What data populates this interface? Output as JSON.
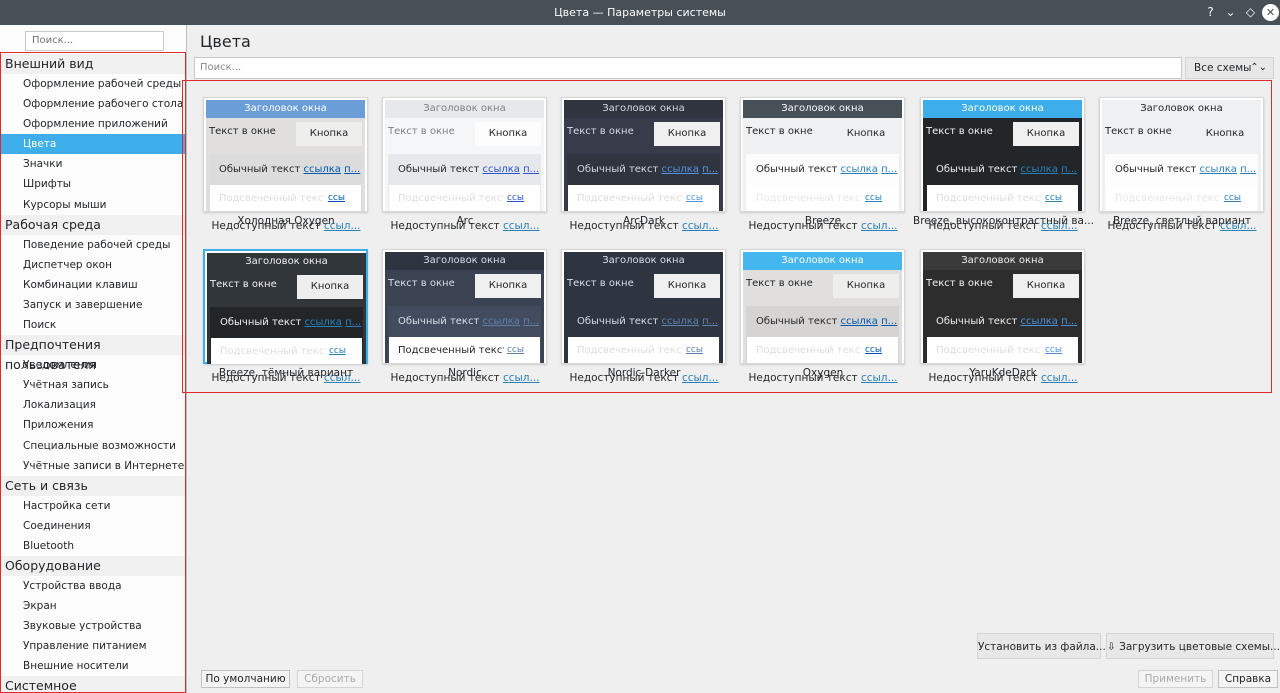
{
  "window": {
    "title": "Цвета — Параметры системы",
    "help_glyph": "?",
    "minimize_glyph": "⌄",
    "maximize_glyph": "◇",
    "close_glyph": "✕"
  },
  "sidebar": {
    "search_placeholder": "Поиск...",
    "sections": [
      {
        "title": "Внешний вид",
        "items": [
          "Оформление рабочей среды",
          "Оформление рабочего стола",
          "Оформление приложений",
          "Цвета",
          "Значки",
          "Шрифты",
          "Курсоры мыши"
        ]
      },
      {
        "title": "Рабочая среда",
        "items": [
          "Поведение рабочей среды",
          "Диспетчер окон",
          "Комбинации клавиш",
          "Запуск и завершение",
          "Поиск"
        ]
      },
      {
        "title": "Предпочтения пользователя",
        "items": [
          "Уведомления",
          "Учётная запись",
          "Локализация",
          "Приложения",
          "Специальные возможности",
          "Учётные записи в Интернете"
        ]
      },
      {
        "title": "Сеть и связь",
        "items": [
          "Настройка сети",
          "Соединения",
          "Bluetooth"
        ]
      },
      {
        "title": "Оборудование",
        "items": [
          "Устройства ввода",
          "Экран",
          "Звуковые устройства",
          "Управление питанием",
          "Внешние носители"
        ]
      },
      {
        "title": "Системное администрирование",
        "items": []
      }
    ],
    "selected_item": "Цвета"
  },
  "main": {
    "page_title": "Цвета",
    "search_placeholder": "Поиск...",
    "filter": {
      "value": "Все схемы",
      "arrow_glyph": "⌃⌄"
    }
  },
  "preview_text": {
    "window_title": "Заголовок окна",
    "window_text": "Текст в окне",
    "button": "Кнопка",
    "normal_text": "Обычный текст",
    "link": "ссылка",
    "visited": "п...",
    "highlighted_text": "Подсвеченный текст",
    "highlighted_link": "ссы",
    "inactive_text": "Недоступный текст",
    "inactive_link": "ссыл..."
  },
  "schemes": [
    {
      "name": "Холодная Oxygen",
      "selected": false,
      "colors": {
        "title_bg": "#6b9ed8",
        "title_fg": "#ffffff",
        "win_bg": "#e0dfde",
        "win_fg": "#232629",
        "btn_bg": "#eeeeec",
        "btn_fg": "#232629",
        "view_bg": "#dcdcdc",
        "view_fg": "#232629",
        "link": "#0057ae",
        "hi_bg": "#ffffff",
        "hi_fg": "#dcdcdc"
      }
    },
    {
      "name": "Arc",
      "selected": false,
      "colors": {
        "title_bg": "#e7e8eb",
        "title_fg": "#7d8287",
        "win_bg": "#f5f6f7",
        "win_fg": "#7d8287",
        "btn_bg": "#fcfcfc",
        "btn_fg": "#232629",
        "view_bg": "#e7e8eb",
        "view_fg": "#232629",
        "link": "#2b55cc",
        "hi_bg": "#ffffff",
        "hi_fg": "#dddddd"
      }
    },
    {
      "name": "ArcDark",
      "selected": false,
      "colors": {
        "title_bg": "#2f343f",
        "title_fg": "#d3dae3",
        "win_bg": "#383c4a",
        "win_fg": "#d3dae3",
        "btn_bg": "#f0f0f0",
        "btn_fg": "#232629",
        "view_bg": "#2f343f",
        "view_fg": "#d3dae3",
        "link": "#5294e2",
        "hi_bg": "#ffffff",
        "hi_fg": "#dddddd"
      }
    },
    {
      "name": "Breeze",
      "selected": false,
      "colors": {
        "title_bg": "#475057",
        "title_fg": "#fcfcfc",
        "win_bg": "#eff0f1",
        "win_fg": "#232629",
        "btn_bg": "#eff0f1",
        "btn_fg": "#232629",
        "view_bg": "#fcfcfc",
        "view_fg": "#232629",
        "link": "#2980b9",
        "hi_bg": "#ffffff",
        "hi_fg": "#e6e6e6"
      }
    },
    {
      "name": "Breeze, высококонтрастный ва...",
      "selected": false,
      "colors": {
        "title_bg": "#3daee9",
        "title_fg": "#ffffff",
        "win_bg": "#232629",
        "win_fg": "#eff0f1",
        "btn_bg": "#f0f0f0",
        "btn_fg": "#232629",
        "view_bg": "#232629",
        "view_fg": "#eff0f1",
        "link": "#2980b9",
        "hi_bg": "#ffffff",
        "hi_fg": "#dddddd"
      }
    },
    {
      "name": "Breeze, светлый вариант",
      "selected": false,
      "colors": {
        "title_bg": "#eff0f1",
        "title_fg": "#232629",
        "win_bg": "#eff0f1",
        "win_fg": "#232629",
        "btn_bg": "#eff0f1",
        "btn_fg": "#232629",
        "view_bg": "#fcfcfc",
        "view_fg": "#232629",
        "link": "#2980b9",
        "hi_bg": "#ffffff",
        "hi_fg": "#e6e6e6"
      }
    },
    {
      "name": "Breeze, тёмный вариант",
      "selected": true,
      "colors": {
        "title_bg": "#31363b",
        "title_fg": "#eff0f1",
        "win_bg": "#31363b",
        "win_fg": "#eff0f1",
        "btn_bg": "#eeeeee",
        "btn_fg": "#232629",
        "view_bg": "#232629",
        "view_fg": "#eff0f1",
        "link": "#2980b9",
        "hi_bg": "#ffffff",
        "hi_fg": "#dddddd"
      }
    },
    {
      "name": "Nordic",
      "selected": false,
      "colors": {
        "title_bg": "#2e3440",
        "title_fg": "#d8dee9",
        "win_bg": "#3b4252",
        "win_fg": "#d8dee9",
        "btn_bg": "#f0f0f0",
        "btn_fg": "#232629",
        "view_bg": "#434c5e",
        "view_fg": "#d8dee9",
        "link": "#5e81ac",
        "hi_bg": "#ffffff",
        "hi_fg": "#232629"
      }
    },
    {
      "name": "Nordic-Darker",
      "selected": false,
      "colors": {
        "title_bg": "#2e3440",
        "title_fg": "#d8dee9",
        "win_bg": "#2e3440",
        "win_fg": "#d8dee9",
        "btn_bg": "#f0f0f0",
        "btn_fg": "#232629",
        "view_bg": "#2e3440",
        "view_fg": "#d8dee9",
        "link": "#5e81ac",
        "hi_bg": "#ffffff",
        "hi_fg": "#dddddd"
      }
    },
    {
      "name": "Oxygen",
      "selected": false,
      "colors": {
        "title_bg": "#45b7ee",
        "title_fg": "#ffffff",
        "win_bg": "#e0dfde",
        "win_fg": "#232629",
        "btn_bg": "#eeeeec",
        "btn_fg": "#232629",
        "view_bg": "#d6d4d2",
        "view_fg": "#232629",
        "link": "#0057ae",
        "hi_bg": "#ffffff",
        "hi_fg": "#dddddd"
      }
    },
    {
      "name": "YaruKdeDark",
      "selected": false,
      "colors": {
        "title_bg": "#3a3a3a",
        "title_fg": "#f0f0f0",
        "win_bg": "#2d2d2d",
        "win_fg": "#f0f0f0",
        "btn_bg": "#f0f0f0",
        "btn_fg": "#232629",
        "view_bg": "#2d2d2d",
        "view_fg": "#f0f0f0",
        "link": "#4a90d9",
        "hi_bg": "#ffffff",
        "hi_fg": "#dddddd"
      }
    }
  ],
  "buttons": {
    "install_file": "Установить из файла...",
    "download": "Загрузить цветовые схемы...",
    "defaults": "По умолчанию",
    "reset": "Сбросить",
    "apply": "Применить",
    "help": "Справка"
  },
  "colors": {
    "accent": "#3daee9",
    "highlight_frame": "#e02b2b",
    "titlebar": "#475057"
  }
}
